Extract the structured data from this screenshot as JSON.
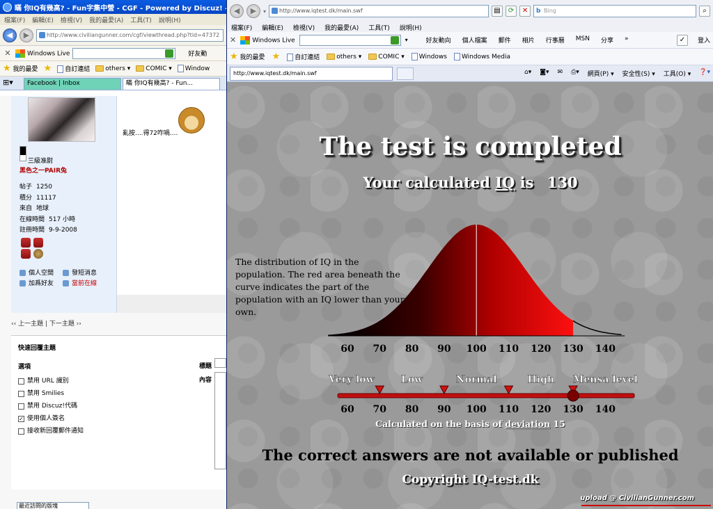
{
  "back_window": {
    "title": "瞞 你IQ有幾高? - Fun字集中營 - CGF - Powered by Discuz! - Win",
    "menu": [
      "檔案(F)",
      "編輯(E)",
      "檢視(V)",
      "我的最愛(A)",
      "工具(T)",
      "說明(H)"
    ],
    "address": "http://www.civiliangunner.com/cgf/viewthread.php?tid=47372",
    "windows_live": "Windows Live",
    "live_more": "好友動",
    "favorites_label": "我的最愛",
    "favorites": [
      "自訂連結",
      "others",
      "COMIC",
      "Window"
    ],
    "tabs": [
      "Facebook | Inbox",
      "瞞 你IQ有幾高? - Fun..."
    ],
    "profile": {
      "rank": "三級准尉",
      "nickname": "黑色之一PAIR兔",
      "stats": [
        {
          "label": "帖子",
          "value": "1250"
        },
        {
          "label": "積分",
          "value": "11117"
        },
        {
          "label": "來自",
          "value": "地球"
        },
        {
          "label": "在線時間",
          "value": "517 小時"
        },
        {
          "label": "註冊時間",
          "value": "9-9-2008"
        }
      ],
      "links": [
        "個人空間",
        "發短消息",
        "加爲好友",
        "當前在線"
      ]
    },
    "post_text": "亂按....得72咋喎....",
    "pager": "‹‹ 上一主題 | 下一主題 ››",
    "quick_reply": {
      "title": "快速回覆主題",
      "options_header": "選項",
      "options": [
        {
          "label": "禁用 URL 識別",
          "checked": false
        },
        {
          "label": "禁用 Smilies",
          "checked": false
        },
        {
          "label": "禁用 Discuz!代碼",
          "checked": false
        },
        {
          "label": "使用個人簽名",
          "checked": true
        },
        {
          "label": "接收新回覆郵件通知",
          "checked": false
        }
      ],
      "subject_label": "標題",
      "content_label": "內容"
    },
    "forum_select": "最近訪問的版塊"
  },
  "front_window": {
    "address": "http://www.iqtest.dk/main.swf",
    "search_placeholder": "Bing",
    "menu": [
      "檔案(F)",
      "編輯(E)",
      "檢視(V)",
      "我的最愛(A)",
      "工具(T)",
      "說明(H)"
    ],
    "windows_live": "Windows Live",
    "live_links": [
      "好友動向",
      "個人檔案",
      "郵件",
      "相片",
      "行事曆",
      "MSN",
      "分享"
    ],
    "signin": "登入",
    "favorites_label": "我的最愛",
    "favorites": [
      "自訂連結",
      "others",
      "COMIC",
      "Windows",
      "Windows Media"
    ],
    "tab_url": "http://www.iqtest.dk/main.swf",
    "tools": [
      "網頁(P)",
      "安全性(S)",
      "工具(O)"
    ]
  },
  "iq_result": {
    "title": "The test is completed",
    "subtitle_pre": "Your calculated",
    "subtitle_iq": "IQ",
    "subtitle_is": "is",
    "score": 130,
    "description": "The distribution of IQ in the population. The red area beneath the curve indicates the part of the population with an IQ lower than your own.",
    "axis_ticks": [
      60,
      70,
      80,
      90,
      100,
      110,
      120,
      130,
      140
    ],
    "levels": [
      "Very low",
      "Low",
      "Normal",
      "High",
      "Mensa level"
    ],
    "level_thresholds": [
      70,
      90,
      110,
      130
    ],
    "basis_pre": "Calculated on the basis of",
    "basis_word": "deviation",
    "deviation": "15",
    "answers_note": "The correct answers are not available or published",
    "copyright": "Copyright IQ-test.dk",
    "colors": {
      "curve_dark": "#000000",
      "curve_red": "#ff0000",
      "slider": "#c01010"
    }
  },
  "watermark": "upload @ CivilianGunner.com"
}
